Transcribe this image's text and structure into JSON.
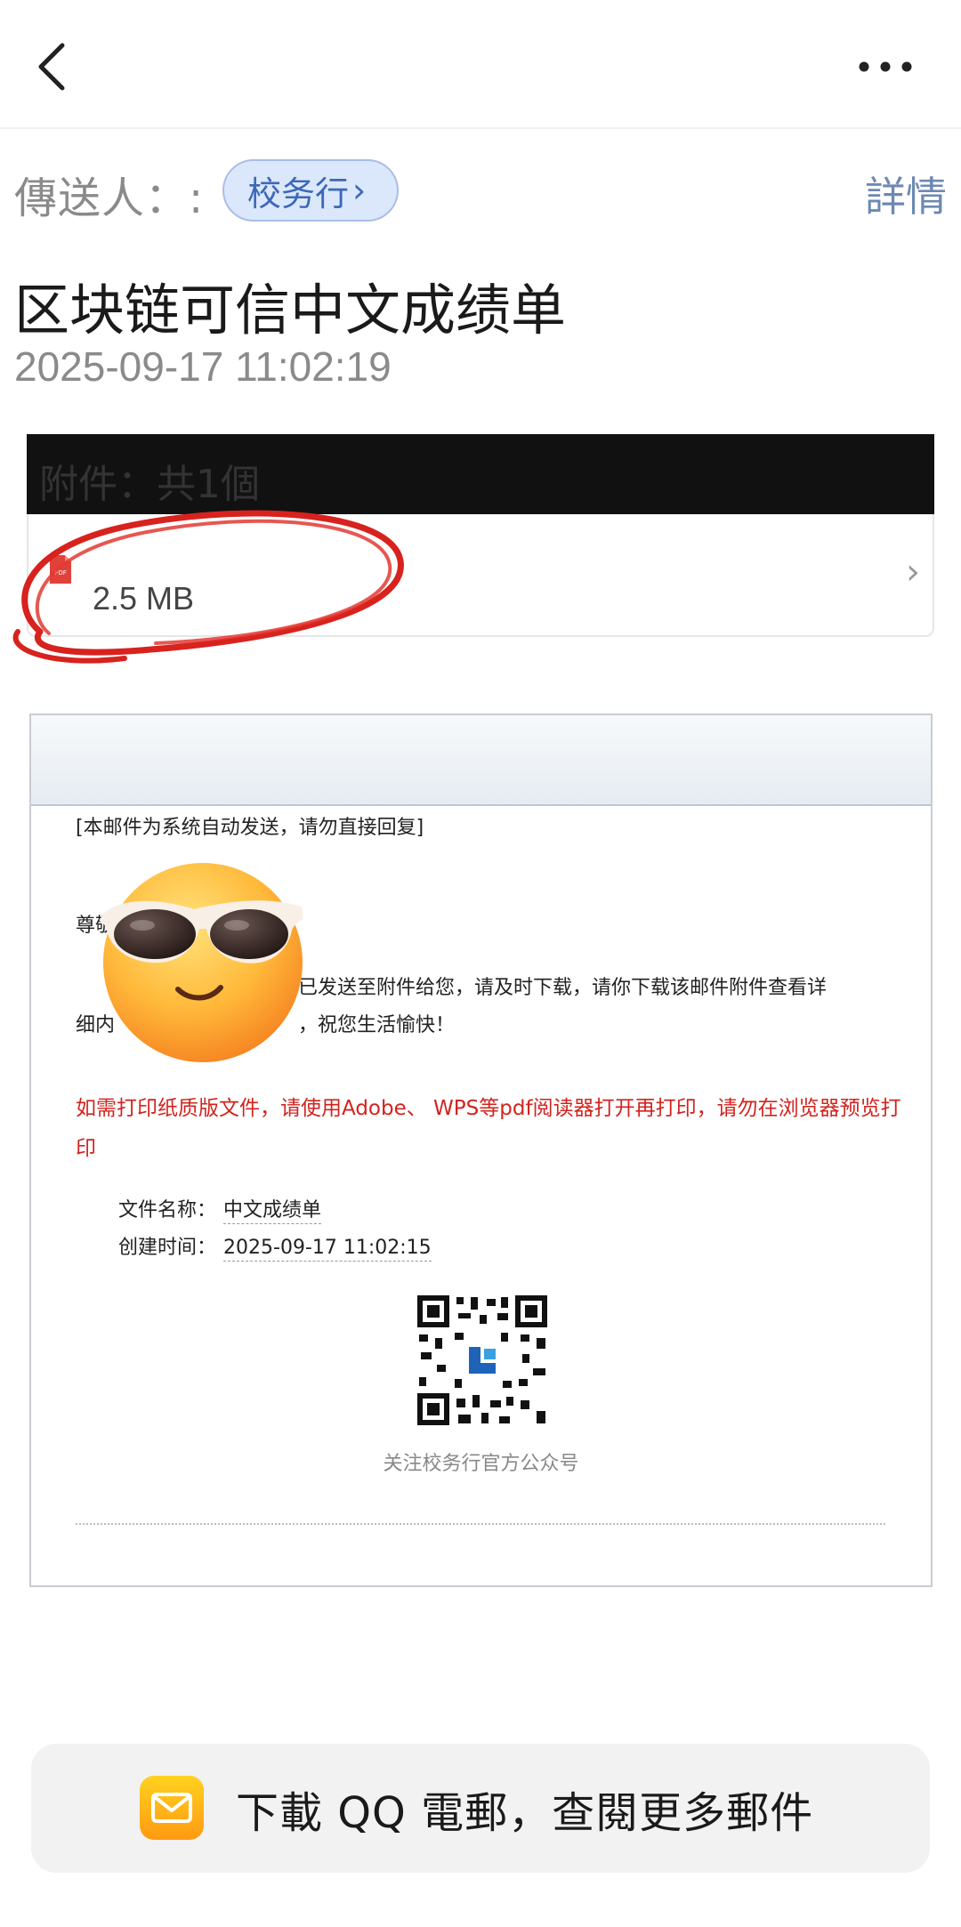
{
  "topbar": {
    "back_icon": "chevron-left-icon",
    "more_icon": "more-horizontal-icon"
  },
  "sender": {
    "label": "傳送人：:",
    "name": "校务行",
    "chip_chevron": "›",
    "details_label": "詳情"
  },
  "email": {
    "subject": "区块链可信中文成绩单",
    "datetime": "2025-09-17 11:02:19"
  },
  "attachments": {
    "header": "附件：共1個",
    "items": [
      {
        "type_icon": "pdf-icon",
        "type_label": "PDF",
        "size": "2.5 MB",
        "chevron": "›"
      }
    ]
  },
  "mail_content": {
    "note": "[本邮件为系统自动发送，请勿直接回复]",
    "greeting": "尊敬",
    "body_line1": "已发送至附件给您，请及时下载，请你下载该邮件附件查看详",
    "body_line2_start": "细内",
    "body_line2_end": "，祝您生活愉快！",
    "warning": "如需打印纸质版文件，请使用Adobe、 WPS等pdf阅读器打开再打印，请勿在浏览器预览打印",
    "file_name_label": "文件名称：",
    "file_name_value": "中文成绩单",
    "created_label": "创建时间：",
    "created_value": "2025-09-17 11:02:15",
    "qr_caption": "关注校务行官方公众号"
  },
  "sticker": {
    "icon": "sunglasses-emoji-icon"
  },
  "download_banner": {
    "icon": "qq-mail-icon",
    "text": "下載 QQ 電郵，查閱更多郵件"
  },
  "colors": {
    "accent_blue": "#3d68b8",
    "chip_bg": "#dbe7fb",
    "warning_red": "#d2231e",
    "banner_bg": "#f2f2f2"
  }
}
